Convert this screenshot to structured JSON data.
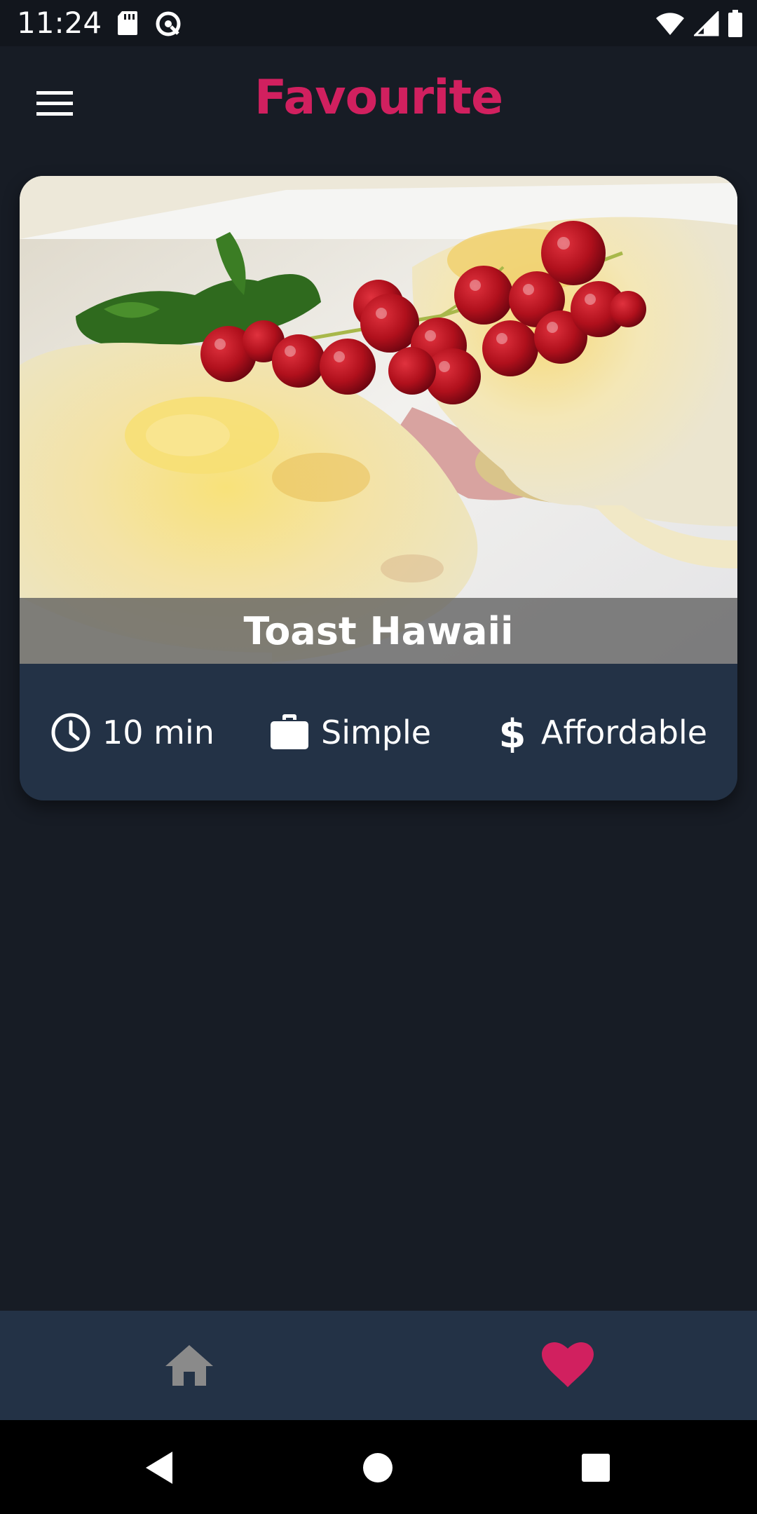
{
  "status_bar": {
    "time": "11:24"
  },
  "app_bar": {
    "title": "Favourite",
    "title_color": "#d1205f"
  },
  "meal": {
    "title": "Toast Hawaii",
    "duration": "10 min",
    "complexity": "Simple",
    "affordability": "Affordable"
  },
  "bottom_nav": {
    "items": [
      {
        "icon": "home-icon",
        "active": false
      },
      {
        "icon": "heart-icon",
        "active": true
      }
    ],
    "active_color": "#d1205f",
    "inactive_color": "#8a8a8a"
  },
  "colors": {
    "background": "#171c25",
    "card": "#233246",
    "accent": "#d1205f"
  }
}
